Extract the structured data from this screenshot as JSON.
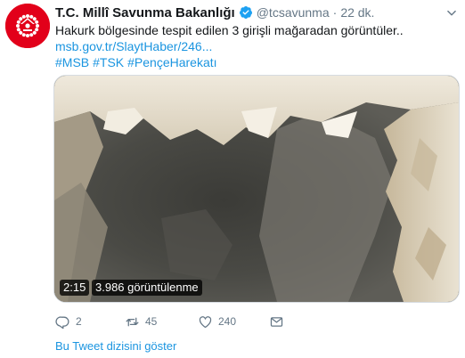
{
  "tweet": {
    "account_name": "T.C. Millî Savunma Bakanlığı",
    "handle": "@tcsavunma",
    "separator": "·",
    "time": "22 dk.",
    "text": "Hakurk bölgesinde tespit edilen 3 girişli mağaradan görüntüler..",
    "link": "msb.gov.tr/SlaytHaber/246...",
    "hashtags": [
      "#MSB",
      "#TSK",
      "#PençeHarekatı"
    ],
    "video": {
      "duration": "2:15",
      "views": "3.986 görüntülenme"
    },
    "actions": {
      "replies": "2",
      "retweets": "45",
      "likes": "240"
    },
    "thread_link": "Bu Tweet dizisini göster"
  },
  "colors": {
    "link_blue": "#1b95e0",
    "muted_gray": "#657786",
    "verified_blue": "#1da1f2",
    "avatar_red": "#e2001a"
  },
  "icons": [
    "verified-badge-icon",
    "chevron-down-icon",
    "reply-icon",
    "retweet-icon",
    "like-icon",
    "direct-message-icon"
  ]
}
